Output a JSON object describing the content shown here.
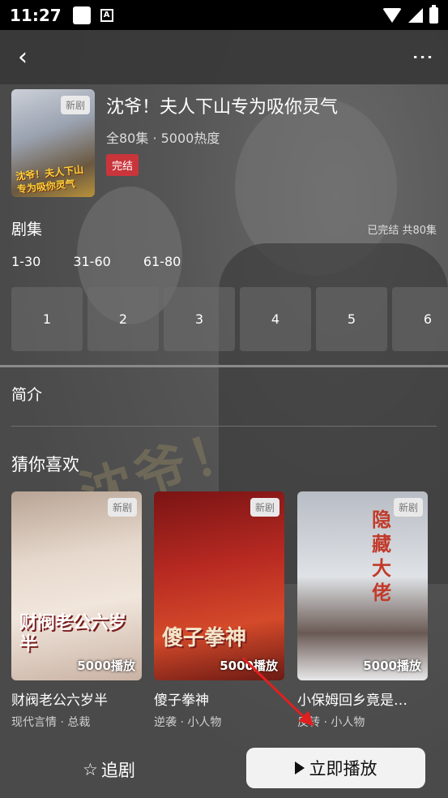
{
  "status_bar": {
    "time": "11:27",
    "icons": [
      "notification-square-icon",
      "a-box-icon",
      "wifi-icon",
      "signal-icon",
      "battery-icon"
    ]
  },
  "nav": {
    "back_icon": "‹",
    "more_icon": "⋮"
  },
  "drama": {
    "title": "沈爷！夫人下山专为吸你灵气",
    "meta": "全80集 · 5000热度",
    "status": "完结",
    "badge": "新剧",
    "poster_text": "沈爷！夫人下山专为吸你灵气"
  },
  "episodes": {
    "heading": "剧集",
    "summary": "已完结 共80集",
    "ranges": [
      "1-30",
      "31-60",
      "61-80"
    ],
    "items": [
      "1",
      "2",
      "3",
      "4",
      "5",
      "6"
    ]
  },
  "intro": {
    "heading": "简介"
  },
  "recommend": {
    "heading": "猜你喜欢",
    "cards": [
      {
        "badge": "新剧",
        "cover_text": "财阀老公六岁半",
        "plays": "5000播放",
        "name": "财阀老公六岁半",
        "tags": "现代言情 · 总裁"
      },
      {
        "badge": "新剧",
        "cover_text": "傻子拳神",
        "plays": "5000播放",
        "name": "傻子拳神",
        "tags": "逆袭 · 小人物"
      },
      {
        "badge": "新剧",
        "cover_text": "隐藏大佬",
        "plays": "5000播放",
        "name": "小保姆回乡竟是…",
        "tags": "反转 · 小人物"
      }
    ]
  },
  "bottom": {
    "follow_icon": "☆",
    "follow_label": "追剧",
    "play_label": "立即播放"
  },
  "colors": {
    "accent_red": "#c9353b",
    "annotation_arrow": "#e02020"
  }
}
